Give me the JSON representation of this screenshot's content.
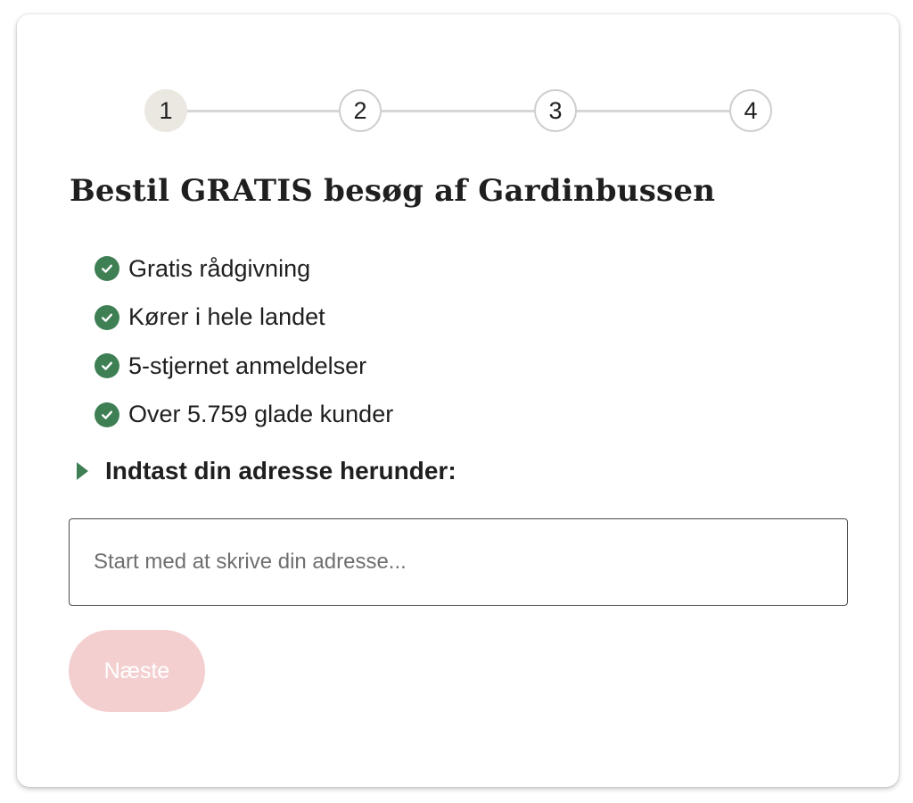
{
  "stepper": {
    "steps": [
      "1",
      "2",
      "3",
      "4"
    ],
    "current_step": 1
  },
  "title": "Bestil GRATIS besøg af Gardinbussen",
  "benefits": [
    "Gratis rådgivning",
    "Kører i hele landet",
    "5-stjernet anmeldelser",
    "Over 5.759 glade kunder"
  ],
  "address_prompt": "Indtast din adresse herunder:",
  "address_input": {
    "value": "",
    "placeholder": "Start med at skrive din adresse..."
  },
  "next_button": {
    "label": "Næste",
    "enabled": false
  },
  "colors": {
    "accent_green": "#3e7f54",
    "active_step_bg": "#ebe8e1",
    "disabled_button_bg": "#f3cfd0"
  },
  "icons": {
    "benefit": "check-circle-icon",
    "prompt": "triangle-right-icon"
  }
}
